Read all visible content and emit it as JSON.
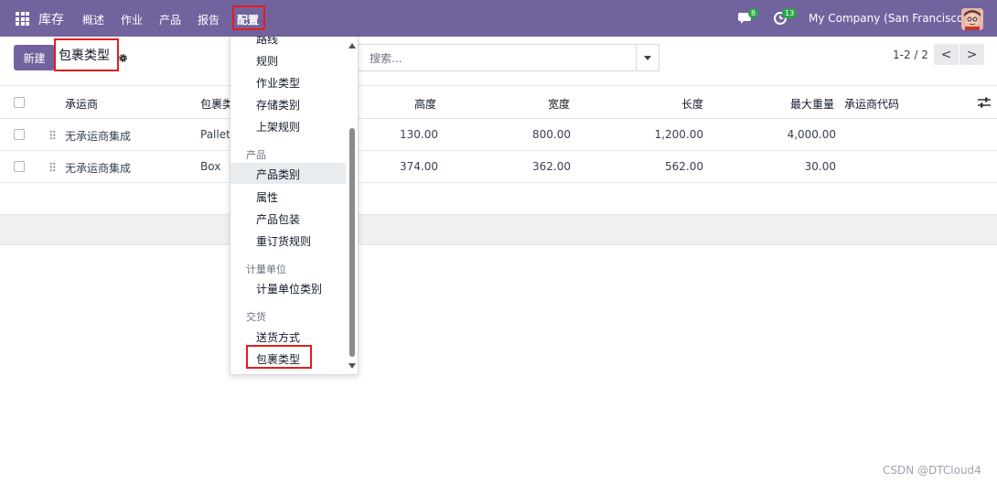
{
  "navbar": {
    "brand": "库存",
    "menu": [
      "概述",
      "作业",
      "产品",
      "报告",
      "配置"
    ],
    "chat_count": "8",
    "activity_count": "13",
    "company": "My Company (San Francisco)"
  },
  "control_panel": {
    "new_button": "新建",
    "title": "包裹类型",
    "search_placeholder": "搜索...",
    "pager": "1-2 / 2",
    "pager_prev": "<",
    "pager_next": ">"
  },
  "table": {
    "columns": [
      "承运商",
      "包裹类",
      "高度",
      "宽度",
      "长度",
      "最大重量",
      "承运商代码"
    ],
    "rows": [
      {
        "carrier": "无承运商集成",
        "type": "Pallet",
        "height": "130.00",
        "width": "800.00",
        "length": "1,200.00",
        "max_weight": "4,000.00",
        "code": ""
      },
      {
        "carrier": "无承运商集成",
        "type": "Box",
        "height": "374.00",
        "width": "362.00",
        "length": "562.00",
        "max_weight": "30.00",
        "code": ""
      }
    ]
  },
  "dropdown": {
    "items_top": [
      "路线",
      "规则",
      "作业类型",
      "存储类别",
      "上架规则"
    ],
    "section_product": "产品",
    "items_product": [
      "产品类别",
      "属性",
      "产品包装",
      "重订货规则"
    ],
    "section_uom": "计量单位",
    "items_uom": [
      "计量单位类别"
    ],
    "section_delivery": "交货",
    "items_delivery": [
      "送货方式",
      "包裹类型"
    ]
  },
  "watermark": "CSDN @DTCloud4",
  "colors": {
    "navbar": "#71639e",
    "highlight": "#e21e1e",
    "badge": "#28a745"
  }
}
